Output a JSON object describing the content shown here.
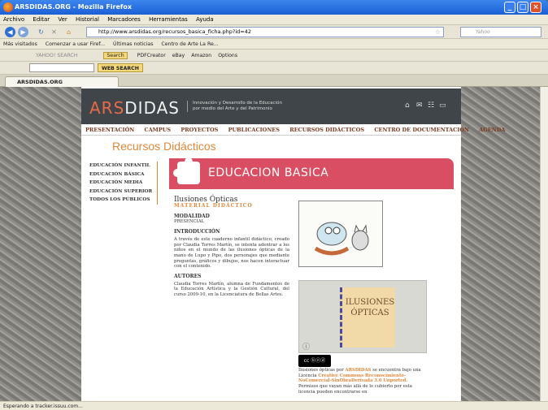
{
  "window": {
    "title": "ARSDIDAS.ORG - Mozilla Firefox"
  },
  "menu": [
    "Archivo",
    "Editar",
    "Ver",
    "Historial",
    "Marcadores",
    "Herramientas",
    "Ayuda"
  ],
  "nav": {
    "url": "http://www.arsdidas.org/recursos_basica_ficha.php?id=42",
    "search_placeholder": "Yahoo"
  },
  "bookmarks": [
    "Más visitados",
    "Comenzar a usar Firef...",
    "Últimas noticias",
    "Centro de Arte La Re..."
  ],
  "toolbar1": {
    "yahoo": "YAHOO! SEARCH",
    "search": "Search",
    "items": [
      "PDFCreator",
      "eBay",
      "Amazon",
      "Options"
    ]
  },
  "toolbar2": {
    "websearch": "WEB SEARCH"
  },
  "tab": {
    "label": "ARSDIDAS.ORG"
  },
  "status": "Esperando a tracker.issuu.com...",
  "site": {
    "logo": "ARSDIDAS",
    "tagline": [
      "Innovación y Desarrollo de la Educación",
      "por medio del Arte y del Patrimonio"
    ],
    "nav": [
      "PRESENTACIÓN",
      "CAMPUS",
      "PROYECTOS",
      "PUBLICACIONES",
      "RECURSOS DIDÁCTICOS",
      "CENTRO DE DOCUMENTACIÓN",
      "AGENDA"
    ],
    "page_title": "Recursos Didácticos",
    "side": [
      "EDUCACIÓN INFANTIL",
      "EDUCACIÓN BÁSICA",
      "EDUCACIÓN MEDIA",
      "EDUCACIÓN SUPERIOR",
      "TODOS LOS PÚBLICOS"
    ],
    "banner": "EDUCACION BASICA",
    "item_title": "Ilusiones Ópticas",
    "item_sub": "MATERIAL DIDÁCTICO",
    "modalidad_label": "MODALIDAD",
    "modalidad": "PRESENCIAL",
    "intro_label": "INTRODUCCIÓN",
    "intro": "A través de este cuaderno infantil didáctico, creado por Claudia Torres Martín, se intenta adentrar a los niños en el mundo de las ilusiones ópticas de la mano de Lupo y Pipo, dos personajes que mediante preguntas, gráficos y dibujos, nos hacen interactuar con el contenido.",
    "autores_label": "AUTORES",
    "autores": "Claudia Torres Martín, alumna de Fundamentos de la Educación Artística y la Gestión Cultural, del curso 2009-10, en la Licenciatura de Bellas Artes.",
    "book_title": "ILUSIONES ÓPTICAS",
    "license_1": "Ilusiones ópticas por",
    "license_org": "ARSDIDAS",
    "license_2": "se encuentra bajo una Licencia",
    "license_name": "Creative Commons Reconocimiento-NoComercial-SinObraDerivada 3.0 Unported.",
    "license_3": "Permisos que vayan más allá de lo cubierto por esta licencia pueden encontrarse en"
  }
}
